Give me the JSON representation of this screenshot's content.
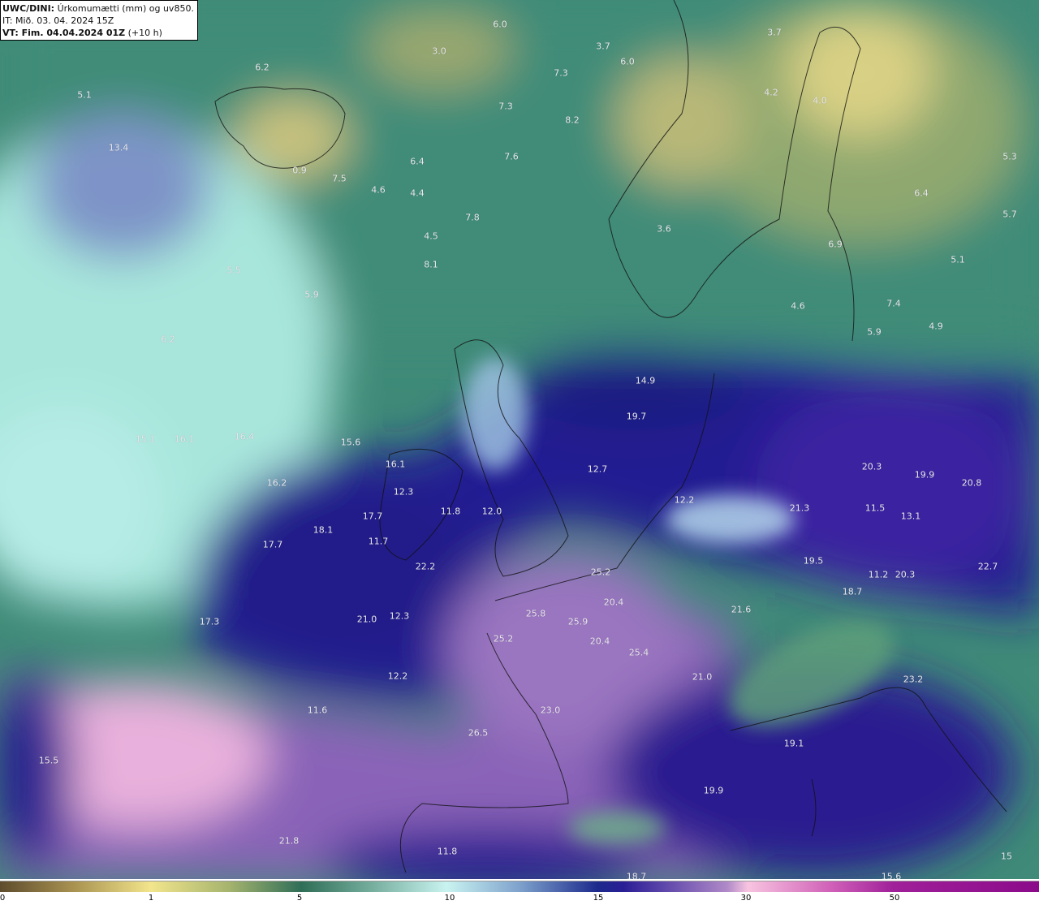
{
  "header": {
    "model": "UWC/DINI:",
    "parameter": "Úrkomumætti (mm) og uv850.",
    "initial_time": "IT: Mið. 03. 04. 2024 15Z",
    "valid_prefix": "VT: Fim. 04.04.2024 01Z",
    "lead_time": "(+10 h)"
  },
  "colorbar": {
    "ticks": [
      "0",
      "1",
      "5",
      "10",
      "15",
      "30",
      "50"
    ],
    "colors": [
      "#5e4c2e",
      "#f2e58c",
      "#2f6e57",
      "#c9f3f0",
      "#1c2a8c",
      "#f8c4e0",
      "#8a0a8a"
    ]
  },
  "map_labels": [
    "6.0",
    "3.0",
    "3.7",
    "6.0",
    "3.7",
    "6.2",
    "5.1",
    "7.3",
    "4.2",
    "4.0",
    "7.3",
    "8.2",
    "13.4",
    "7.6",
    "5.3",
    "6.4",
    "0.9",
    "7.5",
    "4.6",
    "4.4",
    "6.4",
    "5.7",
    "7.8",
    "3.6",
    "4.5",
    "6.9",
    "5.1",
    "8.1",
    "5.5",
    "5.9",
    "4.6",
    "7.4",
    "4.9",
    "5.9",
    "6.2",
    "14.9",
    "19.7",
    "15.1",
    "16.1",
    "16.4",
    "15.6",
    "16.1",
    "20.3",
    "19.9",
    "12.7",
    "20.8",
    "16.2",
    "12.3",
    "12.2",
    "21.3",
    "11.5",
    "13.1",
    "17.7",
    "11.8",
    "12.0",
    "18.1",
    "17.7",
    "11.7",
    "22.2",
    "19.5",
    "22.7",
    "25.2",
    "11.2",
    "20.3",
    "18.7",
    "20.4",
    "21.6",
    "25.8",
    "17.3",
    "21.0",
    "12.3",
    "25.9",
    "25.2",
    "20.4",
    "25.4",
    "21.0",
    "12.2",
    "23.2",
    "11.6",
    "23.0",
    "26.5",
    "19.1",
    "15.5",
    "19.9",
    "21.8",
    "11.8",
    "18.7",
    "15.6",
    "15"
  ]
}
